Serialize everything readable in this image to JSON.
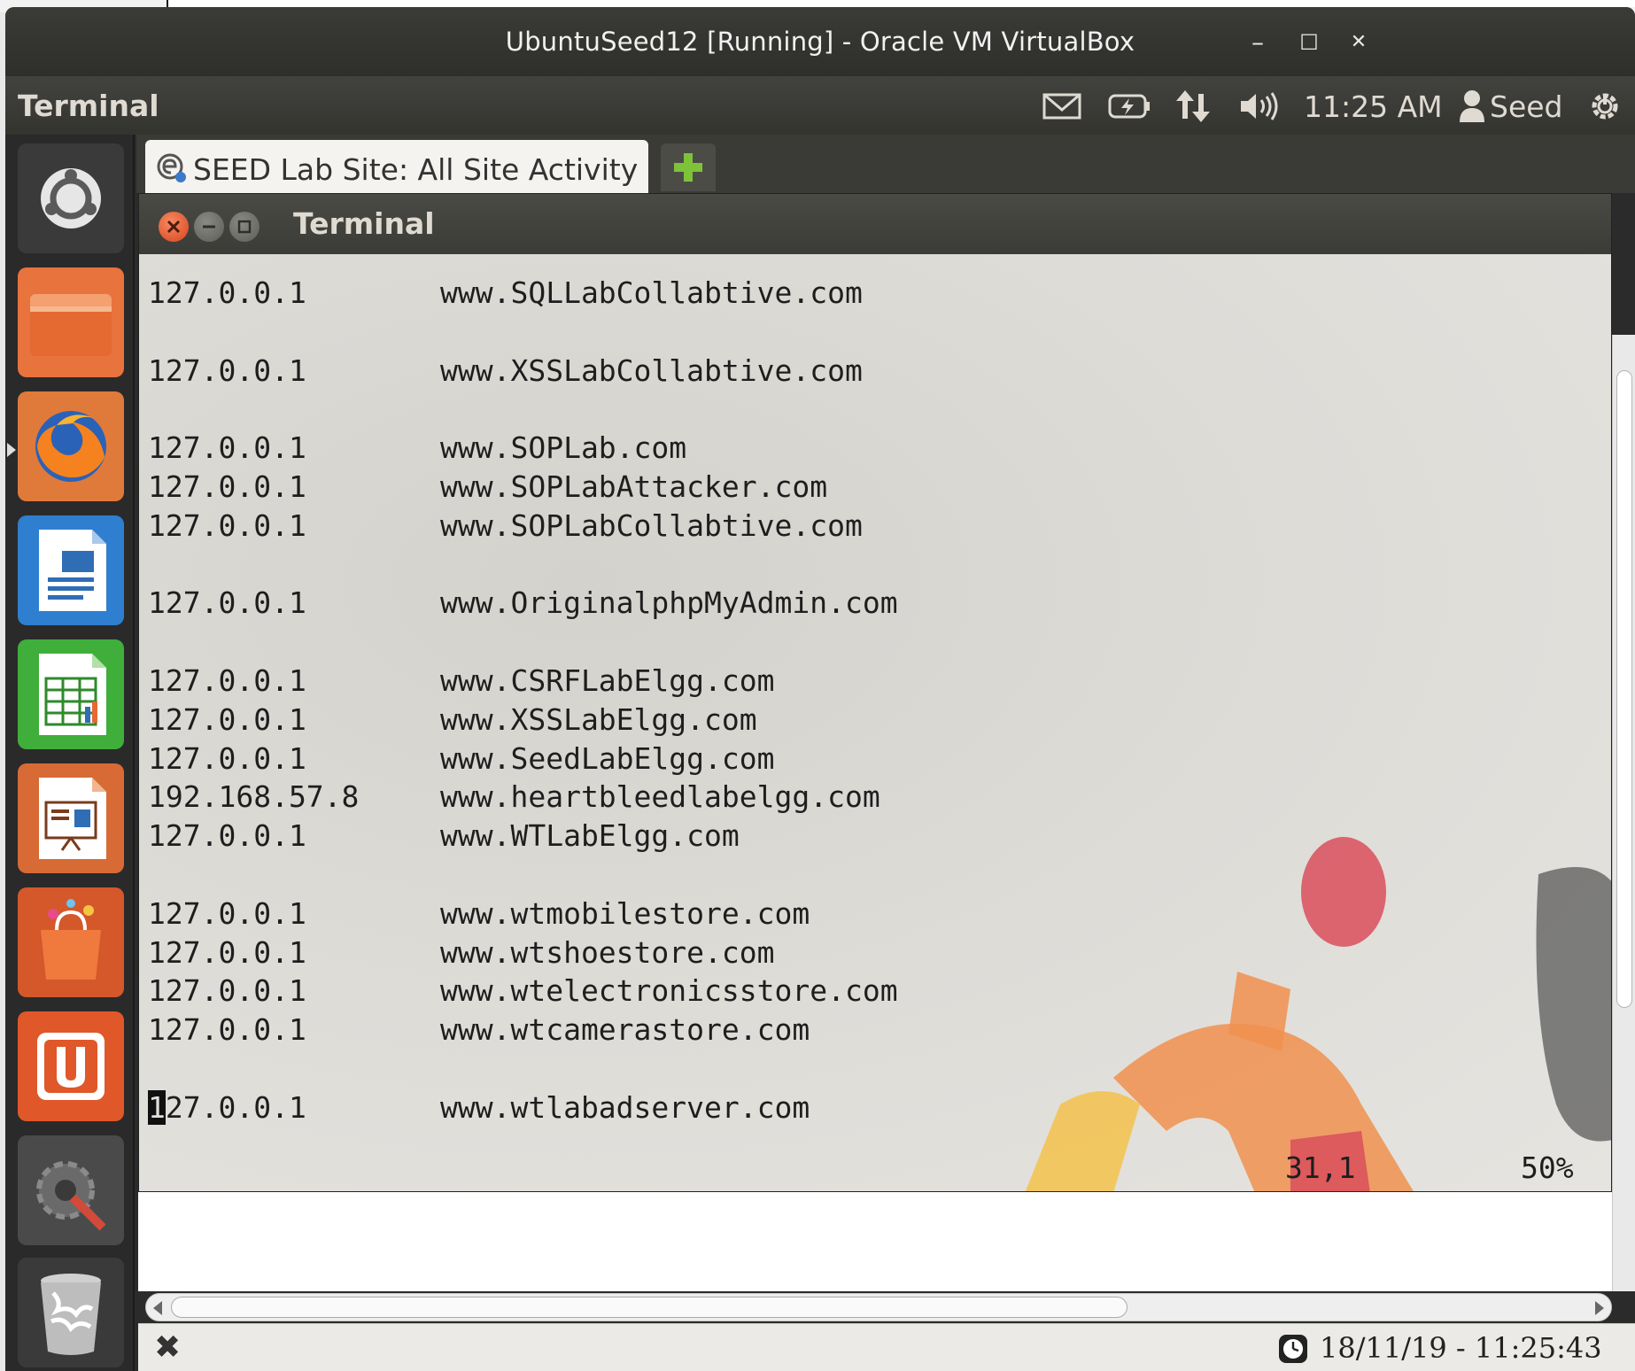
{
  "vm": {
    "title": "UbuntuSeed12 [Running] - Oracle VM VirtualBox",
    "controls": {
      "minimize": "–",
      "maximize": "☐",
      "close": "✕"
    }
  },
  "panel": {
    "app_title": "Terminal",
    "clock": "11:25 AM",
    "user": "Seed",
    "icons": [
      "mail-icon",
      "battery-icon",
      "network-icon",
      "volume-icon",
      "user-icon",
      "power-icon"
    ]
  },
  "launcher": {
    "items": [
      "ubuntu-dash",
      "files",
      "firefox",
      "writer",
      "calc",
      "impress",
      "software-center",
      "ubuntu-one",
      "system-settings",
      "trash"
    ]
  },
  "browser": {
    "tab_label": "SEED Lab Site: All Site Activity"
  },
  "terminal": {
    "title": "Terminal",
    "lines": [
      {
        "ip": "127.0.0.1",
        "host": "www.SQLLabCollabtive.com"
      },
      {
        "ip": "",
        "host": ""
      },
      {
        "ip": "127.0.0.1",
        "host": "www.XSSLabCollabtive.com"
      },
      {
        "ip": "",
        "host": ""
      },
      {
        "ip": "127.0.0.1",
        "host": "www.SOPLab.com"
      },
      {
        "ip": "127.0.0.1",
        "host": "www.SOPLabAttacker.com"
      },
      {
        "ip": "127.0.0.1",
        "host": "www.SOPLabCollabtive.com"
      },
      {
        "ip": "",
        "host": ""
      },
      {
        "ip": "127.0.0.1",
        "host": "www.OriginalphpMyAdmin.com"
      },
      {
        "ip": "",
        "host": ""
      },
      {
        "ip": "127.0.0.1",
        "host": "www.CSRFLabElgg.com"
      },
      {
        "ip": "127.0.0.1",
        "host": "www.XSSLabElgg.com"
      },
      {
        "ip": "127.0.0.1",
        "host": "www.SeedLabElgg.com"
      },
      {
        "ip": "192.168.57.8",
        "host": "www.heartbleedlabelgg.com"
      },
      {
        "ip": "127.0.0.1",
        "host": "www.WTLabElgg.com"
      },
      {
        "ip": "",
        "host": ""
      },
      {
        "ip": "127.0.0.1",
        "host": "www.wtmobilestore.com"
      },
      {
        "ip": "127.0.0.1",
        "host": "www.wtshoestore.com"
      },
      {
        "ip": "127.0.0.1",
        "host": "www.wtelectronicsstore.com"
      },
      {
        "ip": "127.0.0.1",
        "host": "www.wtcamerastore.com"
      },
      {
        "ip": "",
        "host": ""
      }
    ],
    "cursor_line": {
      "cursor_char": "1",
      "ip_rest": "27.0.0.1",
      "host": "www.wtlabadserver.com"
    },
    "vim_position": "31,1",
    "vim_percent": "50%"
  },
  "statusbar": {
    "close_glyph": "✖",
    "timestamp": "18/11/19 - 11:25:43 am"
  },
  "colors": {
    "panel_bg": "#3c3b37",
    "window_close": "#e2542a",
    "terminal_text": "#1e1e1e",
    "wallpaper_red": "#d84a5a",
    "wallpaper_orange": "#f08a4a",
    "wallpaper_yellow": "#f2c24a"
  }
}
